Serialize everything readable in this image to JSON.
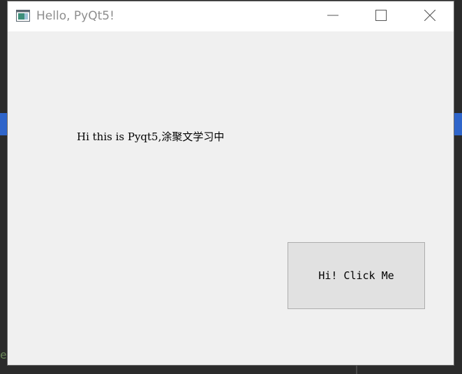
{
  "window": {
    "title": "Hello, PyQt5!"
  },
  "main": {
    "label_text": "Hi this is Pyqt5,涂聚文学习中",
    "button_label": "Hi! Click Me"
  },
  "background": {
    "editor_fragment": "e"
  },
  "icons": {
    "app": "qt-window-icon",
    "minimize": "minimize-icon",
    "maximize": "maximize-icon",
    "close": "close-icon"
  },
  "colors": {
    "titlebar_bg": "#ffffff",
    "window_bg": "#f0f0f0",
    "title_text": "#8e8e8e",
    "button_bg": "#e1e1e1",
    "button_border": "#adadad",
    "editor_highlight": "#2f65ca",
    "editor_bg": "#2b2b2b"
  }
}
